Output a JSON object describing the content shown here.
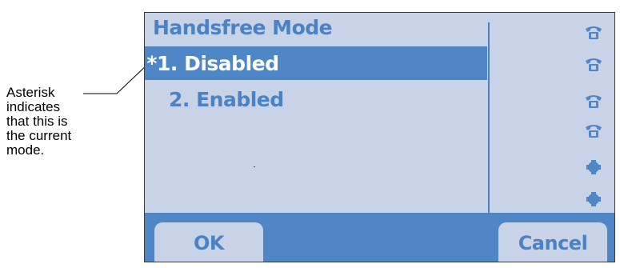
{
  "callout": {
    "lines": [
      "Asterisk",
      "indicates",
      "that this is",
      "the current",
      "mode."
    ]
  },
  "screen": {
    "title": "Handsfree Mode",
    "items": [
      {
        "marker": "*",
        "label": "1. Disabled",
        "selected": true
      },
      {
        "marker": "",
        "label": "2. Enabled",
        "selected": false
      }
    ],
    "side_icons": [
      "phone-line-icon",
      "phone-line-icon",
      "phone-line-icon",
      "phone-line-icon",
      "blank-line-icon",
      "blank-line-icon"
    ],
    "softkeys": {
      "ok": "OK",
      "cancel": "Cancel"
    }
  },
  "colors": {
    "screen_bg": "#c8d3e8",
    "accent": "#4f86c6",
    "text": "#4b82c4"
  }
}
